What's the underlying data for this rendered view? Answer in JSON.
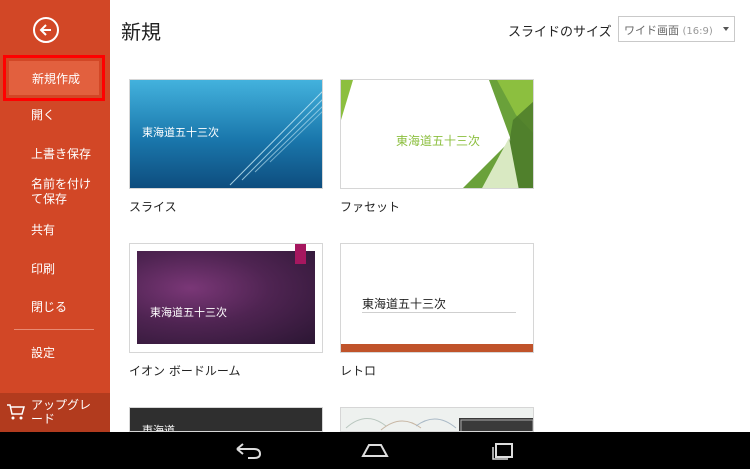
{
  "sidebar": {
    "items": [
      {
        "label": "新規作成",
        "selected": true
      },
      {
        "label": "開く"
      },
      {
        "label": "上書き保存"
      },
      {
        "label": "名前を付けて保存"
      },
      {
        "label": "共有"
      },
      {
        "label": "印刷"
      },
      {
        "label": "閉じる"
      },
      {
        "label": "設定"
      }
    ],
    "upgrade_label": "アップグレード"
  },
  "main": {
    "title": "新規",
    "slide_size_label": "スライドのサイズ",
    "slide_size_value": "ワイド画面",
    "slide_size_ratio": "(16:9)"
  },
  "templates": [
    {
      "name": "スライス",
      "thumb_text": "東海道五十三次"
    },
    {
      "name": "ファセット",
      "thumb_text": "東海道五十三次"
    },
    {
      "name": "イオン ボードルーム",
      "thumb_text": "東海道五十三次"
    },
    {
      "name": "レトロ",
      "thumb_text": "東海道五十三次"
    },
    {
      "name": "",
      "thumb_text": "東海道"
    }
  ],
  "colors": {
    "sidebar": "#d24726",
    "selected": "#e2603e",
    "highlight_border": "#ff0000",
    "facet_green": "#8cbf3f"
  },
  "icons": {
    "back": "back-arrow-icon",
    "upgrade": "cart-icon",
    "nav_back": "android-back-icon",
    "nav_home": "android-home-icon",
    "nav_recents": "android-recents-icon"
  }
}
